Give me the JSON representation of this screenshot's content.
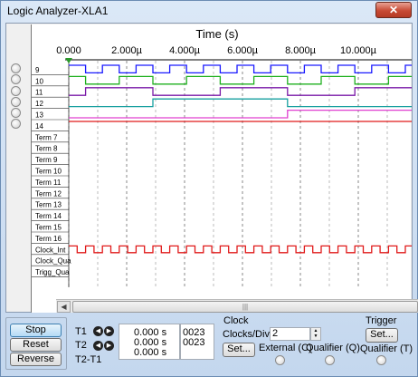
{
  "window": {
    "title": "Logic Analyzer-XLA1",
    "close_label": "✕"
  },
  "graph": {
    "axis_title": "Time (s)",
    "tick_labels": [
      "0.000",
      "2.000µ",
      "4.000µ",
      "6.000µ",
      "8.000µ",
      "10.000µ"
    ],
    "channel_labels": [
      "9",
      "10",
      "11",
      "12",
      "13",
      "14",
      "Term 7",
      "Term 8",
      "Term 9",
      "Term 10",
      "Term 11",
      "Term 12",
      "Term 13",
      "Term 14",
      "Term 15",
      "Term 16",
      "Clock_Int",
      "Clock_Qua",
      "Trigg_Qua"
    ],
    "channel_colors": [
      "#1a1aff",
      "#1fb01f",
      "#7a1aa8",
      "#18a0a0",
      "#e040d0",
      "#e01a1a"
    ],
    "clock_color": "#e01a1a",
    "scroll_grip": "|||"
  },
  "controls": {
    "stop_label": "Stop",
    "reset_label": "Reset",
    "reverse_label": "Reverse",
    "t1_label": "T1",
    "t2_label": "T2",
    "t2t1_label": "T2-T1",
    "t1_time": "0.000 s",
    "t2_time": "0.000 s",
    "t2t1_time": "0.000 s",
    "t1_value": "0023",
    "t2_value": "0023",
    "clock_group_label": "Clock",
    "clocks_div_label": "Clocks/Div",
    "clocks_div_value": "2",
    "clock_set_label": "Set...",
    "external_label": "External (C)",
    "qualifier_q_label": "Qualifier (Q)",
    "trigger_group_label": "Trigger",
    "trigger_set_label": "Set...",
    "qualifier_t_label": "Qualifier (T)"
  }
}
